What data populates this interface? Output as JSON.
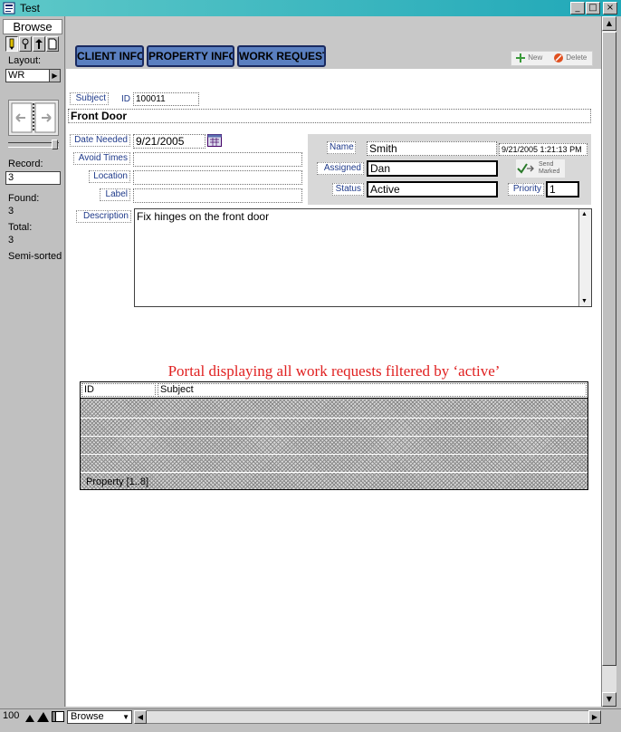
{
  "window": {
    "title": "Test",
    "controls": [
      "_",
      "□",
      "×"
    ]
  },
  "status_area": {
    "mode_tab": "Browse",
    "layout_label": "Layout:",
    "layout_value": "WR",
    "record_label": "Record:",
    "record_value": "3",
    "found_label": "Found:",
    "found_value": "3",
    "total_label": "Total:",
    "total_value": "3",
    "sort_status": "Semi-sorted"
  },
  "tabs": [
    {
      "label": "CLIENT INFO"
    },
    {
      "label": "PROPERTY INFO"
    },
    {
      "label": "WORK REQUEST"
    }
  ],
  "actions": {
    "new_label": "New",
    "delete_label": "Delete"
  },
  "form": {
    "subject_label": "Subject",
    "id_label": "ID",
    "id_value": "100011",
    "subject_value": "Front Door",
    "date_needed_label": "Date Needed",
    "date_needed_value": "9/21/2005",
    "avoid_times_label": "Avoid Times",
    "avoid_times_value": "",
    "location_label": "Location",
    "location_value": "",
    "label_label": "Label",
    "label_value": "",
    "name_label": "Name",
    "name_value": "Smith",
    "timestamp_value": "9/21/2005 1:21:13 PM",
    "assigned_label": "Assigned",
    "assigned_value": "Dan",
    "send_marked_label": "Send\nMarked",
    "status_label": "Status",
    "status_value": "Active",
    "priority_label": "Priority",
    "priority_value": "1",
    "description_label": "Description",
    "description_value": "Fix hinges on the front door"
  },
  "portal": {
    "annotation": "Portal displaying all work requests filtered by ‘active’",
    "col_id": "ID",
    "col_subject": "Subject",
    "footer": "Property [1..8]"
  },
  "bottom_bar": {
    "zoom": "100",
    "mode": "Browse"
  },
  "colors": {
    "title_bar": "#20a8b8",
    "tab_button": "#5a7fc0",
    "label_text": "#1f3a8a",
    "annotation": "#e02020"
  }
}
